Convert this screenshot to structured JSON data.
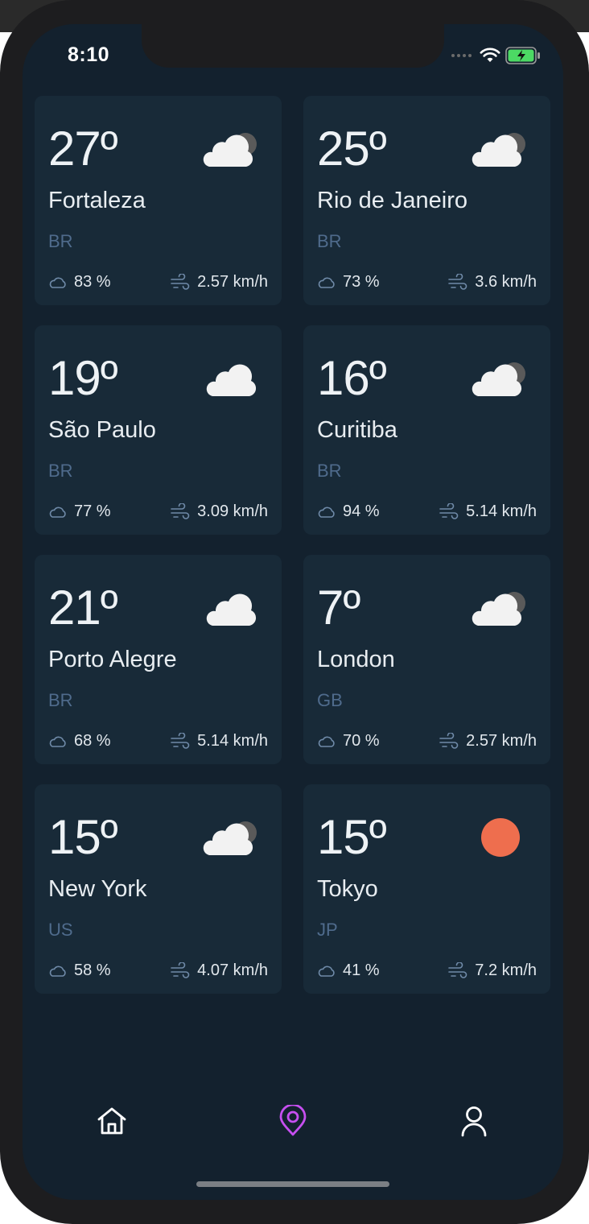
{
  "status_bar": {
    "time": "8:10"
  },
  "cards": [
    {
      "temp": "27º",
      "city": "Fortaleza",
      "country": "BR",
      "humidity": "83 %",
      "wind": "2.57 km/h",
      "icon": "cloud-with-dark-cloud-icon"
    },
    {
      "temp": "25º",
      "city": "Rio de Janeiro",
      "country": "BR",
      "humidity": "73 %",
      "wind": "3.6 km/h",
      "icon": "cloud-with-dark-cloud-icon"
    },
    {
      "temp": "19º",
      "city": "São Paulo",
      "country": "BR",
      "humidity": "77 %",
      "wind": "3.09 km/h",
      "icon": "cloud-icon"
    },
    {
      "temp": "16º",
      "city": "Curitiba",
      "country": "BR",
      "humidity": "94 %",
      "wind": "5.14 km/h",
      "icon": "cloud-with-dark-cloud-icon"
    },
    {
      "temp": "21º",
      "city": "Porto Alegre",
      "country": "BR",
      "humidity": "68 %",
      "wind": "5.14 km/h",
      "icon": "cloud-icon"
    },
    {
      "temp": "7º",
      "city": "London",
      "country": "GB",
      "humidity": "70 %",
      "wind": "2.57 km/h",
      "icon": "cloud-with-dark-cloud-icon"
    },
    {
      "temp": "15º",
      "city": "New York",
      "country": "US",
      "humidity": "58 %",
      "wind": "4.07 km/h",
      "icon": "cloud-with-dark-cloud-icon"
    },
    {
      "temp": "15º",
      "city": "Tokyo",
      "country": "JP",
      "humidity": "41 %",
      "wind": "7.2 km/h",
      "icon": "sun-icon"
    }
  ],
  "tab_bar": {
    "items": [
      {
        "name": "home-icon",
        "active": false
      },
      {
        "name": "location-pin-icon",
        "active": true
      },
      {
        "name": "user-icon",
        "active": false
      }
    ],
    "active_color": "#c64ff0",
    "inactive_color": "#ffffff"
  },
  "colors": {
    "background": "#13212e",
    "card": "#182a38",
    "country_text": "#4f6b8c",
    "sun": "#ee6e4e",
    "battery": "#4cd964"
  }
}
